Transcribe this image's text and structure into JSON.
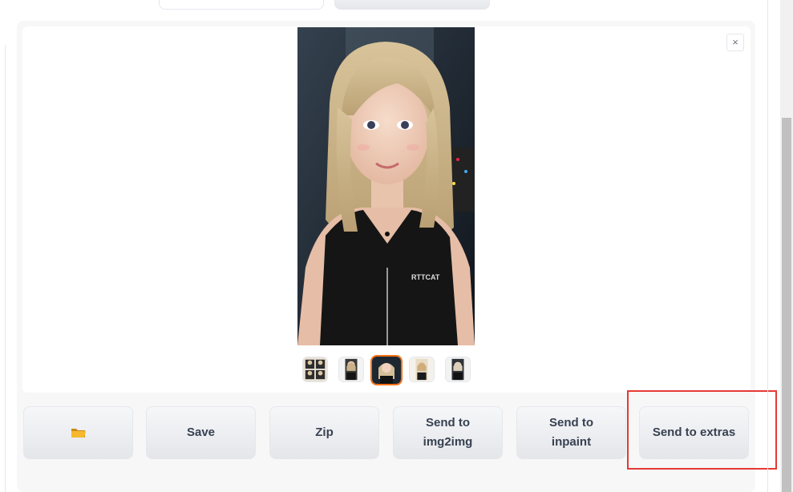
{
  "gallery": {
    "close_label": "×",
    "thumbnail_count": 5,
    "selected_thumbnail": 3,
    "image_text": "RTTCAT"
  },
  "buttons": {
    "folder_icon": "folder-icon",
    "save_label": "Save",
    "zip_label": "Zip",
    "send_img2img_line1": "Send to",
    "send_img2img_line2": "img2img",
    "send_inpaint_line1": "Send to",
    "send_inpaint_line2": "inpaint",
    "send_extras_label": "Send to extras"
  },
  "colors": {
    "selected_thumb_border": "#f97316",
    "highlight_box": "#e53935",
    "folder_icon": "#f5b82e"
  }
}
